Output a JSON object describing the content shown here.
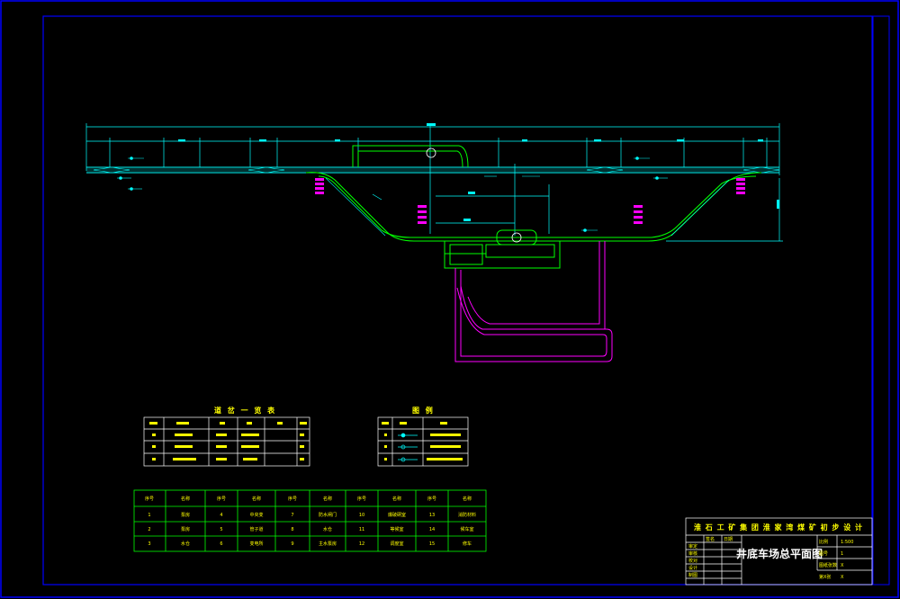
{
  "colors": {
    "background": "#000000",
    "frame": "#0000ff",
    "geometry_cyan": "#00ffff",
    "geometry_green": "#00ff00",
    "geometry_magenta": "#ff00ff",
    "text_yellow": "#ffff00",
    "title_white": "#ffffff",
    "dimension_box": "#00ffff"
  },
  "drawing": {
    "title": "井底车场总平面图",
    "project_header": "淮 石 工 矿 集 团 淮 家 湾 煤 矿 初 步 设 计",
    "rev_labels": [
      "签名",
      "日期"
    ],
    "role_labels": [
      "审定",
      "审核",
      "校对",
      "设计",
      "制图"
    ],
    "field_labels": [
      "比例",
      "图号",
      "图纸张数",
      "第X张"
    ],
    "field_values": [
      "1:500",
      "1",
      "X",
      "X"
    ]
  },
  "legend_turnout": {
    "title": "道 岔 一 览 表"
  },
  "legend_symbols": {
    "title": "图 例"
  },
  "rooms_table": {
    "header_labels": [
      "序号",
      "名称",
      "序号",
      "名称",
      "序号",
      "名称",
      "序号",
      "名称",
      "序号",
      "名称"
    ],
    "rows": [
      [
        "1",
        "泵房",
        "4",
        "中央变",
        "7",
        "防水闸门",
        "10",
        "爆破硐室",
        "13",
        "消防材料"
      ],
      [
        "2",
        "泵房",
        "5",
        "管子道",
        "8",
        "水仓",
        "11",
        "等候室",
        "14",
        "候车室"
      ],
      [
        "3",
        "水仓",
        "6",
        "变电所",
        "9",
        "主水泵房",
        "12",
        "调度室",
        "15",
        "修车"
      ]
    ]
  }
}
